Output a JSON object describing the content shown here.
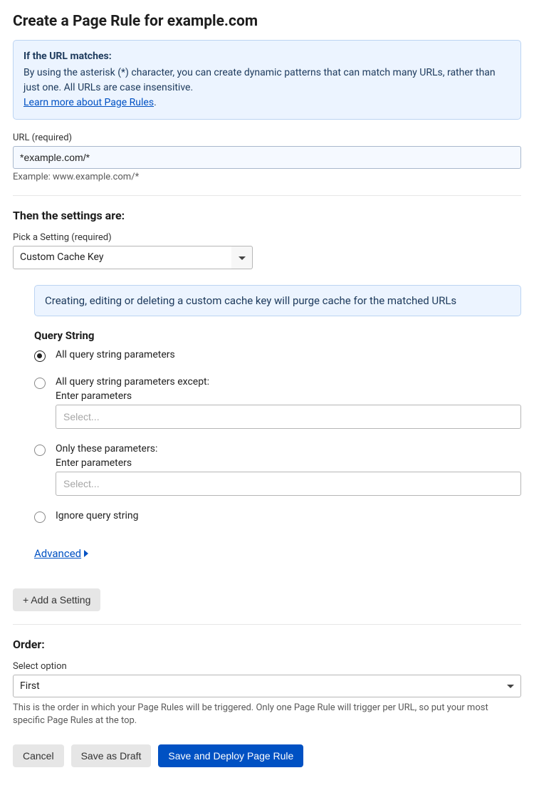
{
  "title": "Create a Page Rule for example.com",
  "infoBox": {
    "heading": "If the URL matches:",
    "body": "By using the asterisk (*) character, you can create dynamic patterns that can match many URLs, rather than just one. All URLs are case insensitive.",
    "linkText": "Learn more about Page Rules",
    "period": "."
  },
  "urlField": {
    "label": "URL (required)",
    "value": "*example.com/*",
    "example": "Example: www.example.com/*"
  },
  "settingsHeading": "Then the settings are:",
  "settingPicker": {
    "label": "Pick a Setting (required)",
    "value": "Custom Cache Key"
  },
  "purgeNotice": "Creating, editing or deleting a custom cache key will purge cache for the matched URLs",
  "queryString": {
    "title": "Query String",
    "options": {
      "all": "All query string parameters",
      "except": "All query string parameters except:",
      "only": "Only these parameters:",
      "ignore": "Ignore query string"
    },
    "enterParams": "Enter parameters",
    "selectPlaceholder": "Select..."
  },
  "advanced": "Advanced",
  "addSetting": "+ Add a Setting",
  "order": {
    "title": "Order:",
    "label": "Select option",
    "value": "First",
    "helper": "This is the order in which your Page Rules will be triggered. Only one Page Rule will trigger per URL, so put your most specific Page Rules at the top."
  },
  "buttons": {
    "cancel": "Cancel",
    "draft": "Save as Draft",
    "deploy": "Save and Deploy Page Rule"
  }
}
